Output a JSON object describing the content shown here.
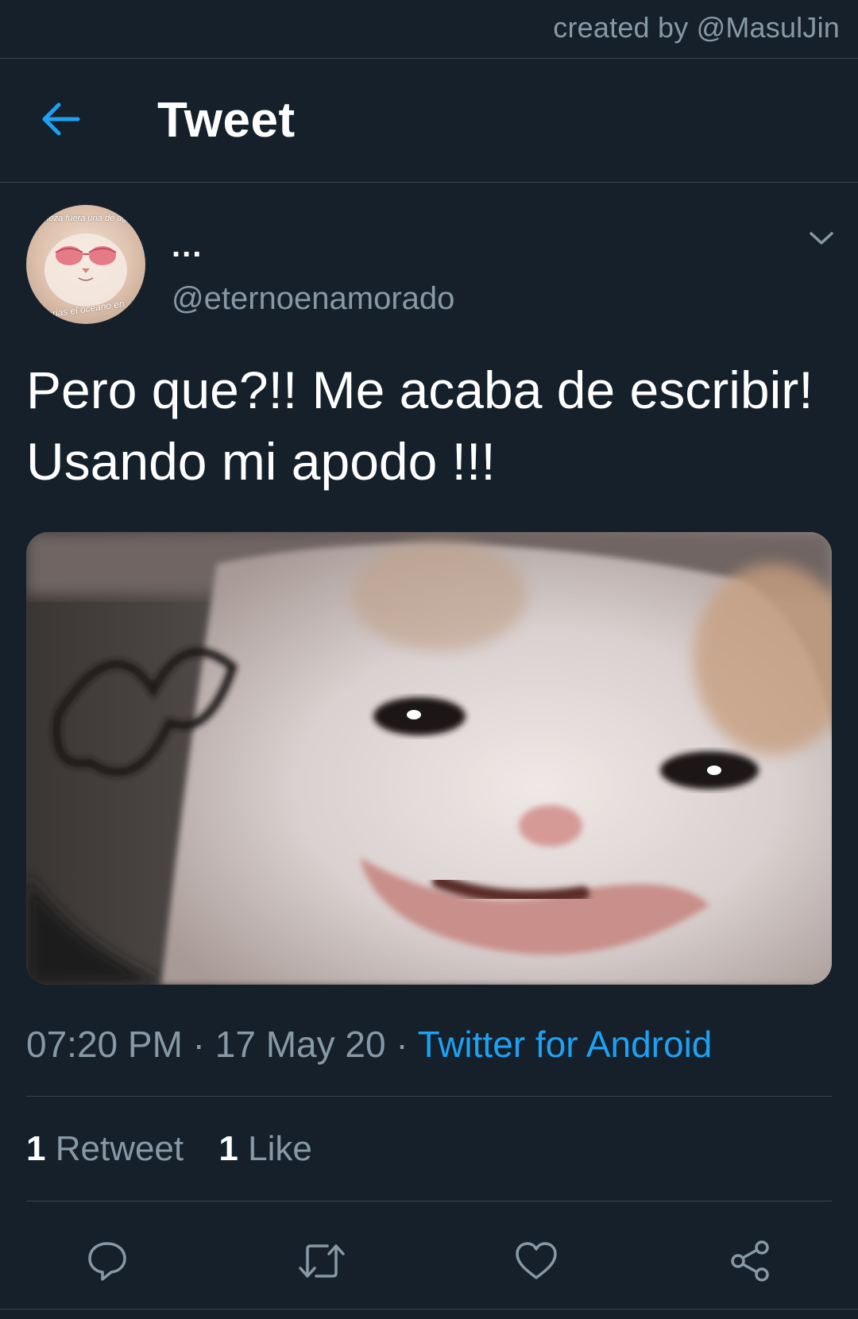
{
  "watermark": {
    "text": "created by @MasulJin"
  },
  "header": {
    "title": "Tweet",
    "back_icon": "arrow-left-icon"
  },
  "tweet": {
    "avatar": {
      "caption_top": "belleza fuera una de agua",
      "caption_bottom": "erias el oceano en"
    },
    "display_name": "...",
    "handle": "@eternoenamorado",
    "text": "Pero que?!! Me acaba de escribir! Usando mi apodo !!!",
    "time": "07:20 PM",
    "date": "17 May 20",
    "separator": " · ",
    "source": "Twitter for Android",
    "stats": {
      "retweets_count": "1",
      "retweets_label": "Retweet",
      "likes_count": "1",
      "likes_label": "Like"
    }
  },
  "colors": {
    "background": "#15202b",
    "border": "#38444d",
    "secondary_text": "#8899a6",
    "accent": "#1da1f2"
  },
  "actions": [
    {
      "name": "reply",
      "icon": "reply-icon"
    },
    {
      "name": "retweet",
      "icon": "retweet-icon"
    },
    {
      "name": "like",
      "icon": "heart-icon"
    },
    {
      "name": "share",
      "icon": "share-icon"
    }
  ]
}
